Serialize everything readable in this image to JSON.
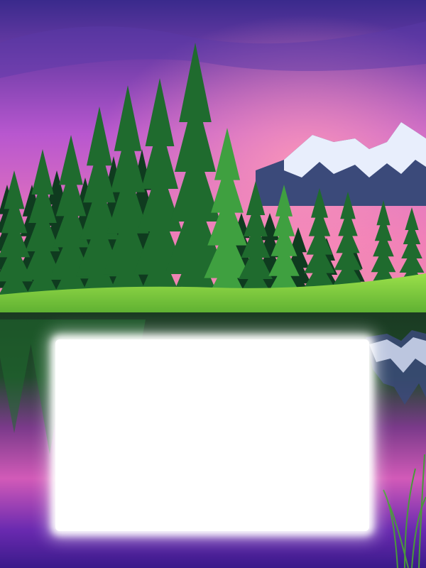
{
  "scene": {
    "colors": {
      "sky_top": "#3a2a8c",
      "sky_mid": "#c25bd0",
      "sky_glow": "#f07ab4",
      "mountain_rock": "#3b4a7a",
      "mountain_snow": "#e8eefc",
      "forest_dark": "#0f3b1f",
      "forest_mid": "#1f6b2e",
      "forest_light": "#3fa040",
      "meadow": "#79d43a",
      "water_top": "#1d4a2a",
      "water_pink": "#d45ab8",
      "water_purple": "#4a2aa0",
      "frame_fill": "#ffffff"
    },
    "icons": [
      "pine-tree-icon",
      "mountain-icon"
    ]
  }
}
